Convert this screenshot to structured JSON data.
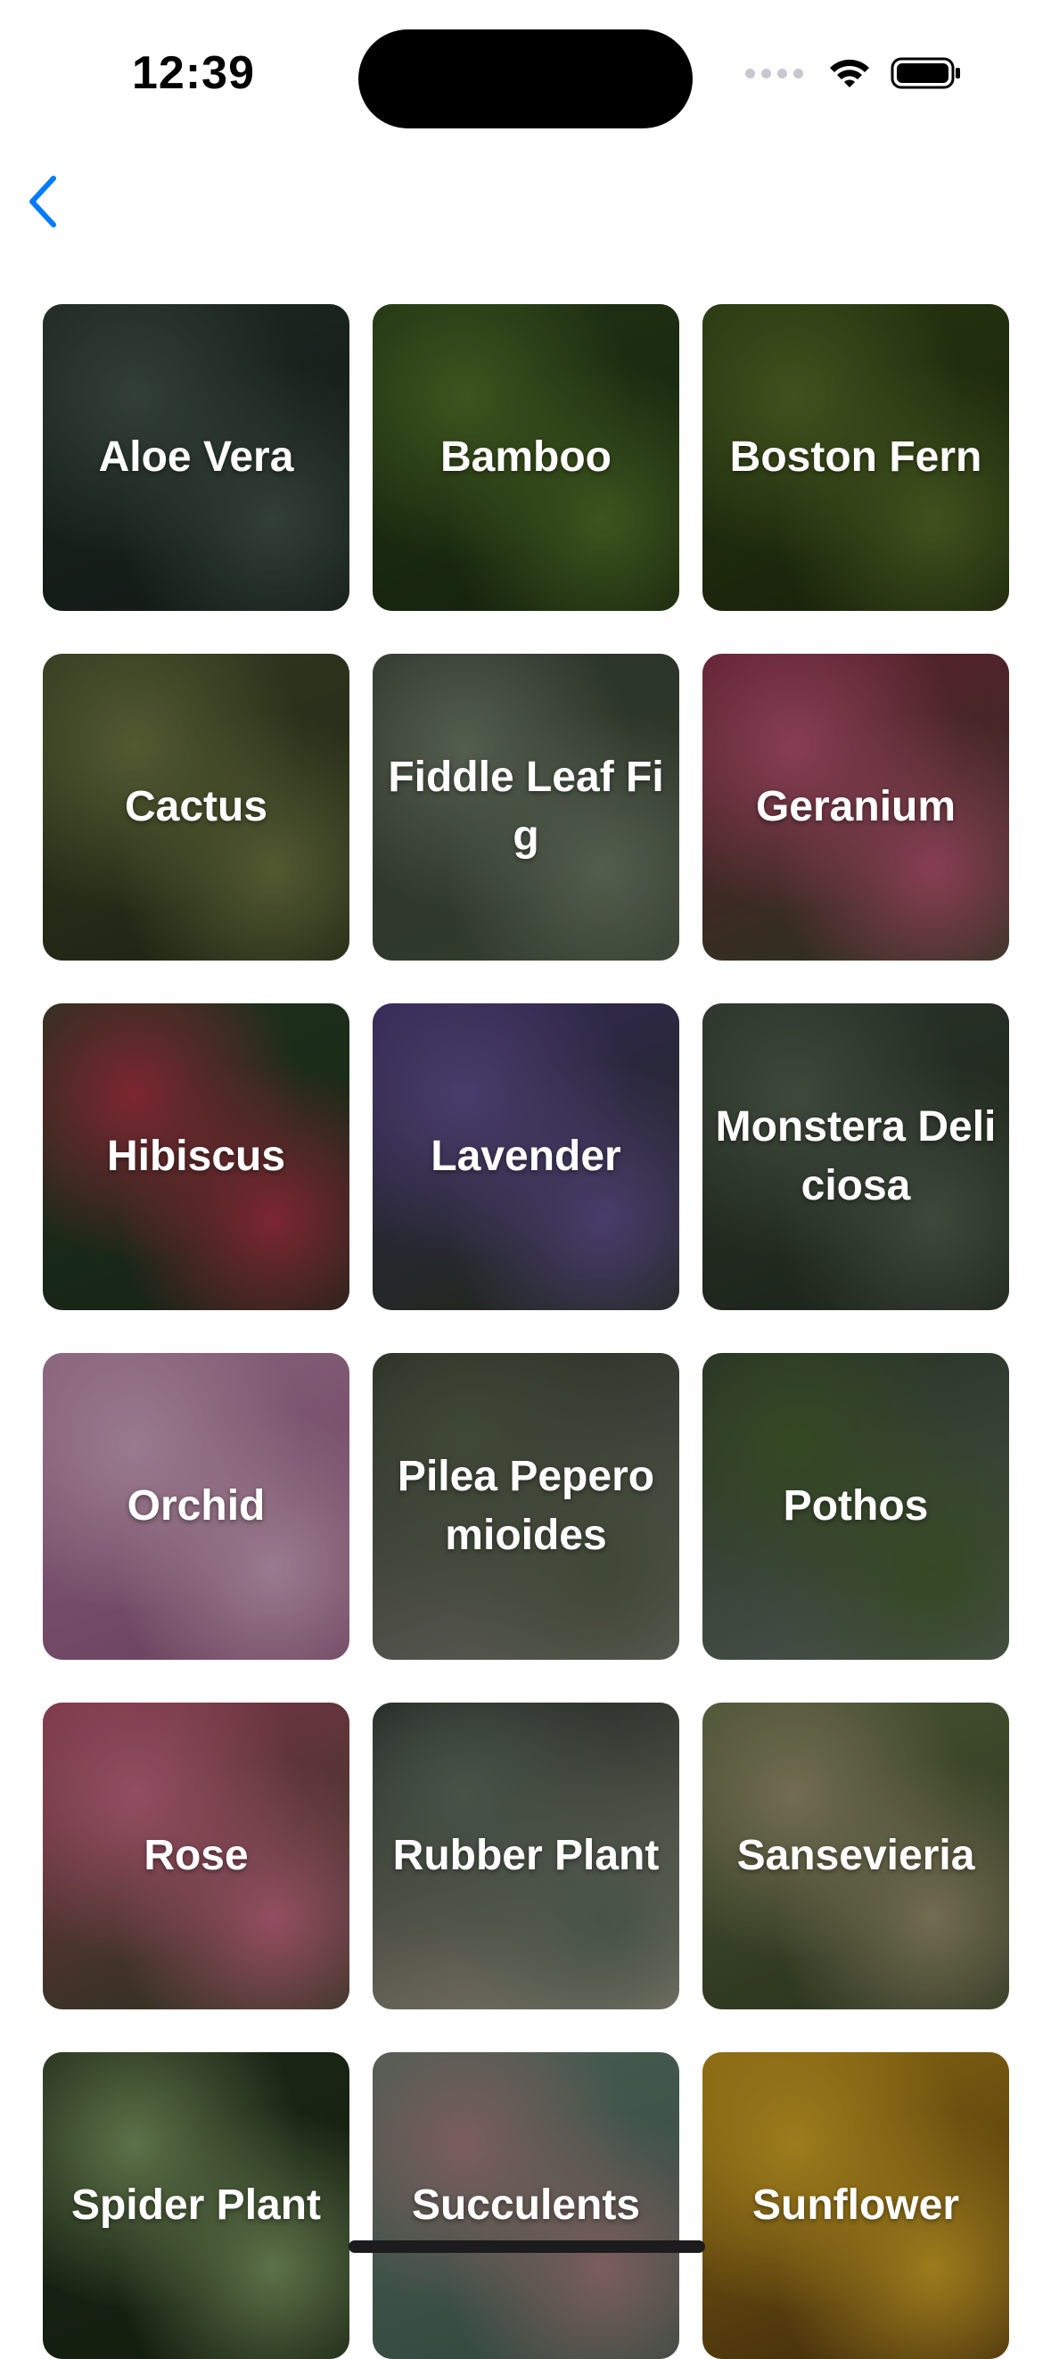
{
  "status_bar": {
    "time": "12:39"
  },
  "nav": {
    "back_icon": "chevron-left-icon",
    "accent_color": "#007aff"
  },
  "plants": [
    {
      "name": "Aloe Vera",
      "slug": "aloe-vera",
      "colors": [
        "#2c3a33",
        "#4a5d52",
        "#1b2520"
      ]
    },
    {
      "name": "Bamboo",
      "slug": "bamboo",
      "colors": [
        "#2f4a1e",
        "#5b7d2c",
        "#1f3214"
      ]
    },
    {
      "name": "Boston Fern",
      "slug": "boston-fern",
      "colors": [
        "#3a4f1a",
        "#61792b",
        "#223010"
      ]
    },
    {
      "name": "Cactus",
      "slug": "cactus",
      "colors": [
        "#4a5430",
        "#7a8448",
        "#2c331c"
      ]
    },
    {
      "name": "Fiddle Leaf Fig",
      "slug": "fiddle-leaf-fig",
      "colors": [
        "#3e4a3a",
        "#7c8a74",
        "#4c5a44"
      ]
    },
    {
      "name": "Geranium",
      "slug": "geranium",
      "colors": [
        "#8a2d45",
        "#c95c7b",
        "#3a4a2c"
      ]
    },
    {
      "name": "Hibiscus",
      "slug": "hibiscus",
      "colors": [
        "#2e4a2a",
        "#b8394a",
        "#1f3320"
      ]
    },
    {
      "name": "Lavender",
      "slug": "lavender",
      "colors": [
        "#4a3c7a",
        "#6b5aa0",
        "#2e3a22"
      ]
    },
    {
      "name": "Monstera Deliciosa",
      "slug": "monstera-deliciosa",
      "colors": [
        "#3d4a3c",
        "#5c6b57",
        "#2a3527"
      ]
    },
    {
      "name": "Orchid",
      "slug": "orchid",
      "colors": [
        "#c88fb5",
        "#e3b5d0",
        "#9c5f88"
      ]
    },
    {
      "name": "Pilea Peperomioides",
      "slug": "pilea-peperomioides",
      "colors": [
        "#3c4436",
        "#5e6a50",
        "#8a8a80"
      ]
    },
    {
      "name": "Pothos",
      "slug": "pothos",
      "colors": [
        "#3a4a36",
        "#4f6b35",
        "#6d7a70"
      ]
    },
    {
      "name": "Rose",
      "slug": "rose",
      "colors": [
        "#b5506a",
        "#d9738f",
        "#3c4a2a"
      ]
    },
    {
      "name": "Rubber Plant",
      "slug": "rubber-plant",
      "colors": [
        "#2c3530",
        "#6a7a6a",
        "#b5b09a"
      ]
    },
    {
      "name": "Sansevieria",
      "slug": "sansevieria",
      "colors": [
        "#6a7a4a",
        "#a8a07a",
        "#3c4a2a"
      ]
    },
    {
      "name": "Spider Plant",
      "slug": "spider-plant",
      "colors": [
        "#2a3a22",
        "#8aa86a",
        "#1c2a16"
      ]
    },
    {
      "name": "Succulents",
      "slug": "succulents",
      "colors": [
        "#6a8a7a",
        "#b58a8a",
        "#4a6a5a"
      ]
    },
    {
      "name": "Sunflower",
      "slug": "sunflower",
      "colors": [
        "#c99a1a",
        "#e8b72a",
        "#5a3a12"
      ]
    }
  ]
}
